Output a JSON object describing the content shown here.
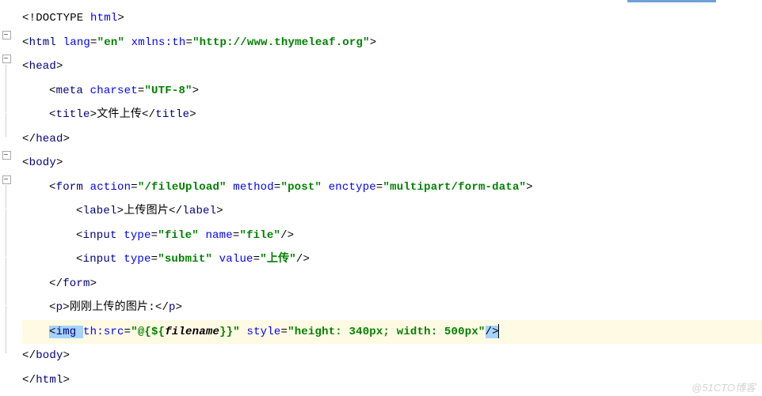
{
  "watermark": "@51CTO博客",
  "lines": {
    "l1": {
      "t1": "<!DOCTYPE ",
      "t2": "html",
      "t3": ">"
    },
    "l2": {
      "t1": "<",
      "t2": "html ",
      "a1": "lang",
      "v1": "\"en\" ",
      "a2": "xmlns:th",
      "v2": "\"http://www.thymeleaf.org\"",
      "t3": ">"
    },
    "l3": {
      "t1": "<",
      "t2": "head",
      "t3": ">"
    },
    "l4": {
      "t1": "<",
      "t2": "meta ",
      "a1": "charset",
      "v1": "\"UTF-8\"",
      "t3": ">"
    },
    "l5": {
      "t1": "<",
      "t2": "title",
      "t3": ">",
      "txt": "文件上传",
      "t4": "</",
      "t5": "title",
      "t6": ">"
    },
    "l6": {
      "t1": "</",
      "t2": "head",
      "t3": ">"
    },
    "l7": {
      "t1": "<",
      "t2": "body",
      "t3": ">"
    },
    "l8": {
      "t1": "<",
      "t2": "form ",
      "a1": "action",
      "v1": "\"/fileUpload\" ",
      "a2": "method",
      "v2": "\"post\" ",
      "a3": "enctype",
      "v3": "\"multipart/form-data\"",
      "t3": ">"
    },
    "l9": {
      "t1": "<",
      "t2": "label",
      "t3": ">",
      "txt": "上传图片",
      "t4": "</",
      "t5": "label",
      "t6": ">"
    },
    "l10": {
      "t1": "<",
      "t2": "input ",
      "a1": "type",
      "v1": "\"file\" ",
      "a2": "name",
      "v2": "\"file\"",
      "t3": "/>"
    },
    "l11": {
      "t1": "<",
      "t2": "input ",
      "a1": "type",
      "v1": "\"submit\" ",
      "a2": "value",
      "v2": "\"上传\"",
      "t3": "/>"
    },
    "l12": {
      "t1": "</",
      "t2": "form",
      "t3": ">"
    },
    "l13": {
      "t1": "<",
      "t2": "p",
      "t3": ">",
      "txt": "刚刚上传的图片:",
      "t4": "</",
      "t5": "p",
      "t6": ">"
    },
    "l14": {
      "t1": "<",
      "t2": "img ",
      "a1": "th:src",
      "v1a": "\"@{${",
      "ident": "filename",
      "v1b": "}}\" ",
      "a2": "style",
      "v2": "\"height: 340px; width: 500px\"",
      "t3": "/>"
    },
    "l15": {
      "t1": "</",
      "t2": "body",
      "t3": ">"
    },
    "l16": {
      "t1": "</",
      "t2": "html",
      "t3": ">"
    }
  }
}
